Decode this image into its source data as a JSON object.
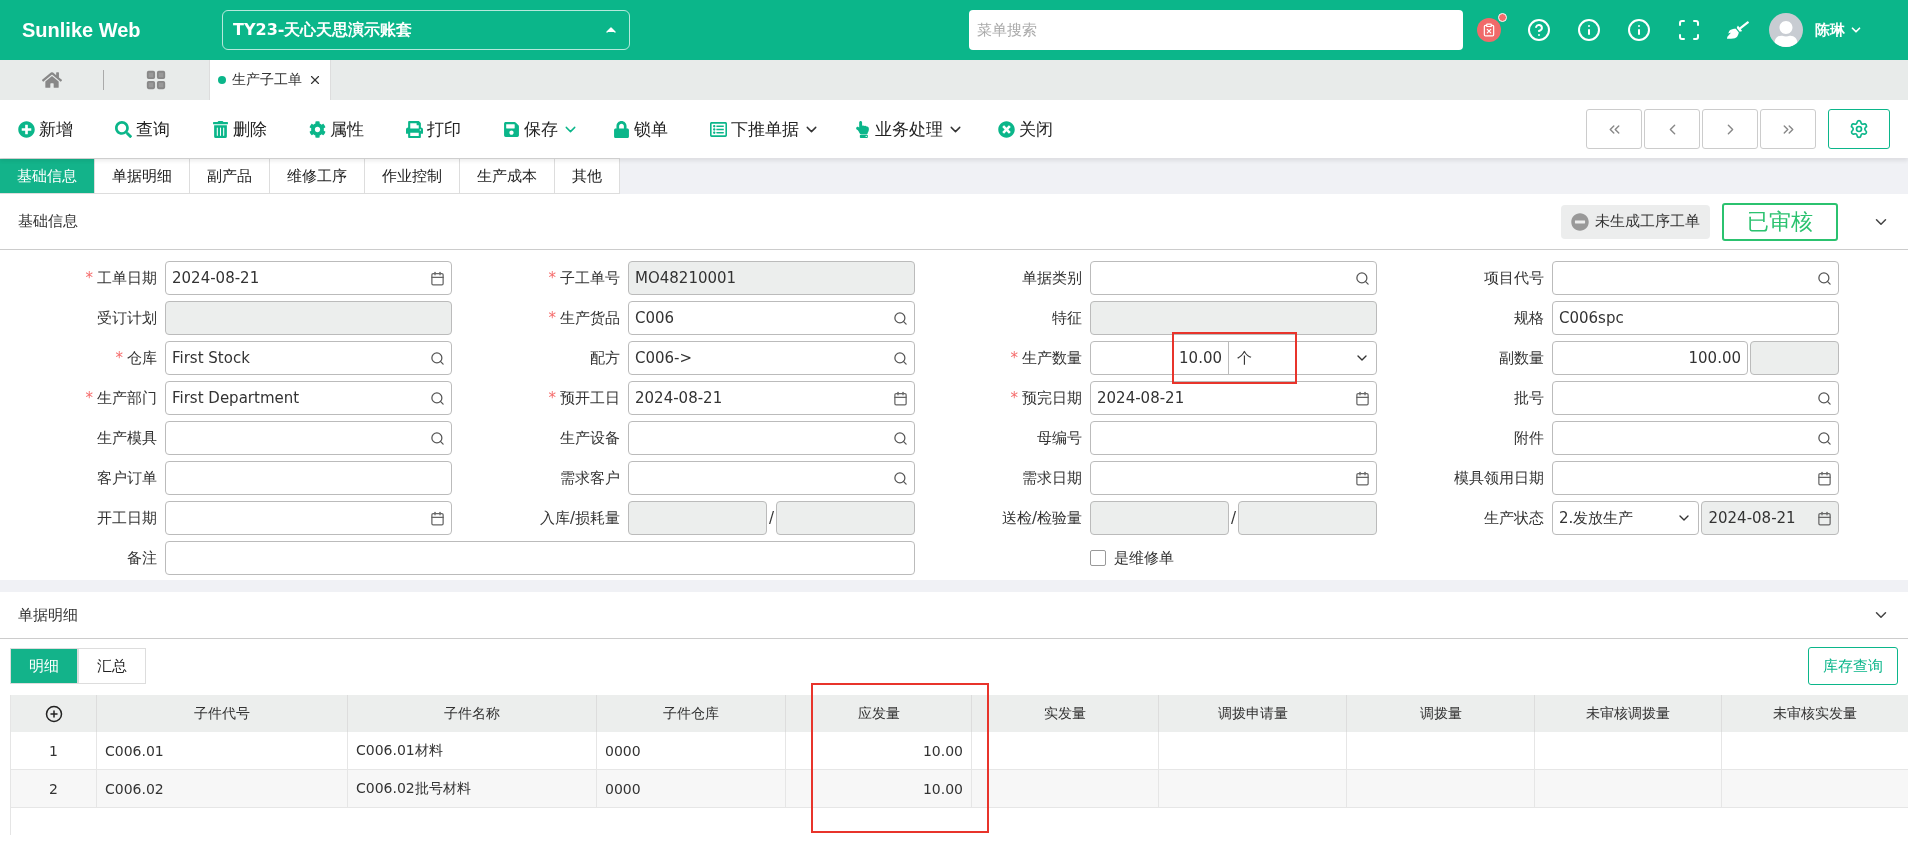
{
  "header": {
    "brand": "Sunlike Web",
    "account": "TY23-天心天思演示账套",
    "search": {
      "placeholder": "菜单搜索"
    },
    "user": "陈琳",
    "notification": true
  },
  "page_tabs": [
    {
      "label": "生产子工单",
      "selected": true
    }
  ],
  "toolbar": [
    {
      "label": "新增",
      "has_menu": false
    },
    {
      "label": "查询",
      "has_menu": false
    },
    {
      "label": "删除",
      "has_menu": false
    },
    {
      "label": "属性",
      "has_menu": false
    },
    {
      "label": "打印",
      "has_menu": false
    },
    {
      "label": "保存",
      "has_menu": true
    },
    {
      "label": "锁单",
      "has_menu": false
    },
    {
      "label": "下推单据",
      "has_menu": true
    },
    {
      "label": "业务处理",
      "has_menu": true
    },
    {
      "label": "关闭",
      "has_menu": false
    }
  ],
  "section_tabs": [
    {
      "label": "基础信息",
      "selected": true
    },
    {
      "label": "单据明细",
      "selected": false
    },
    {
      "label": "副产品",
      "selected": false
    },
    {
      "label": "维修工序",
      "selected": false
    },
    {
      "label": "作业控制",
      "selected": false
    },
    {
      "label": "生产成本",
      "selected": false
    },
    {
      "label": "其他",
      "selected": false
    }
  ],
  "basic_section": {
    "title": "基础信息",
    "process_status": "未生成工序工单",
    "approval": "已审核",
    "expanded": true
  },
  "fields": [
    {
      "label": "工单日期",
      "marker": "*",
      "kind": "date",
      "value": "2024-08-21"
    },
    {
      "label": "子工单号",
      "marker": "*",
      "kind": "readonly",
      "value": "MO48210001"
    },
    {
      "label": "单据类别",
      "kind": "lookup"
    },
    {
      "label": "项目代号",
      "kind": "lookup"
    },
    {
      "label": "受订计划",
      "kind": "readonly"
    },
    {
      "label": "生产货品",
      "marker": "*",
      "kind": "lookup",
      "value": "C006"
    },
    {
      "label": "特征",
      "kind": "readonly"
    },
    {
      "label": "规格",
      "kind": "text",
      "value": "C006spc"
    },
    {
      "label": "仓库",
      "marker": "*",
      "kind": "lookup",
      "value": "First Stock"
    },
    {
      "label": "配方",
      "kind": "lookup",
      "value": "C006->"
    },
    {
      "label": "生产数量",
      "marker": "*",
      "kind": "quantity",
      "value": "10.00",
      "unit": "个",
      "highlighted": true
    },
    {
      "label": "副数量",
      "kind": "number",
      "value": "100.00"
    },
    {
      "label": "生产部门",
      "marker": "*",
      "kind": "lookup",
      "value": "First Department"
    },
    {
      "label": "预开工日",
      "marker": "*",
      "kind": "date",
      "value": "2024-08-21"
    },
    {
      "label": "预完日期",
      "marker": "*",
      "kind": "date",
      "value": "2024-08-21"
    },
    {
      "label": "批号",
      "kind": "lookup"
    },
    {
      "label": "生产模具",
      "kind": "lookup"
    },
    {
      "label": "生产设备",
      "kind": "lookup"
    },
    {
      "label": "母编号",
      "kind": "text"
    },
    {
      "label": "附件",
      "kind": "lookup"
    },
    {
      "label": "客户订单",
      "kind": "text"
    },
    {
      "label": "需求客户",
      "kind": "lookup"
    },
    {
      "label": "需求日期",
      "kind": "date"
    },
    {
      "label": "模具领用日期",
      "kind": "date"
    },
    {
      "label": "开工日期",
      "kind": "date"
    },
    {
      "label": "入库/损耗量",
      "kind": "split",
      "separator": "/"
    },
    {
      "label": "送检/检验量",
      "kind": "split",
      "separator": "/"
    },
    {
      "label": "生产状态",
      "kind": "status",
      "value": "2.发放生产",
      "date": "2024-08-21"
    },
    {
      "label": "备注",
      "kind": "wide"
    },
    {
      "label": "是维修单",
      "kind": "checkbox",
      "checked": false
    }
  ],
  "detail_section": {
    "title": "单据明细",
    "expanded": true,
    "view_tabs": [
      {
        "label": "明细",
        "selected": true
      },
      {
        "label": "汇总",
        "selected": false
      }
    ],
    "stock_button": "库存查询"
  },
  "table": {
    "columns": [
      {
        "label": "子件代号"
      },
      {
        "label": "子件名称"
      },
      {
        "label": "子件仓库"
      },
      {
        "label": "应发量",
        "highlighted": true
      },
      {
        "label": "实发量"
      },
      {
        "label": "调拨申请量"
      },
      {
        "label": "调拨量"
      },
      {
        "label": "未审核调拨量"
      },
      {
        "label": "未审核实发量"
      }
    ],
    "rows": [
      {
        "index": "1",
        "cells": [
          "C006.01",
          "C006.01材料",
          "0000",
          "10.00",
          "",
          "",
          "",
          "",
          ""
        ]
      },
      {
        "index": "2",
        "cells": [
          "C006.02",
          "C006.02批号材料",
          "0000",
          "10.00",
          "",
          "",
          "",
          "",
          ""
        ]
      }
    ]
  }
}
